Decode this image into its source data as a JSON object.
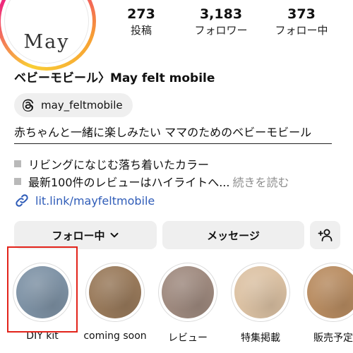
{
  "avatar": {
    "text": "May"
  },
  "stats": [
    {
      "value": "273",
      "label": "投稿"
    },
    {
      "value": "3,183",
      "label": "フォロワー"
    },
    {
      "value": "373",
      "label": "フォロー中"
    }
  ],
  "profile": {
    "name": "ベビーモビール〉May felt mobile",
    "threads_handle": "may_feltmobile"
  },
  "bio": {
    "line1": "赤ちゃんと一緒に楽しみたい ママのためのベビーモビール",
    "line2": "リビングになじむ落ち着いたカラー",
    "line3": "最新100件のレビューはハイライトへ...",
    "more": "続きを読む"
  },
  "link": {
    "text": "lit.link/mayfeltmobile"
  },
  "buttons": {
    "following": "フォロー中",
    "message": "メッセージ"
  },
  "highlights": [
    {
      "label": "DIY kit",
      "color": "#7f93a6"
    },
    {
      "label": "coming soon",
      "color": "#9a7b5c"
    },
    {
      "label": "レビュー",
      "color": "#a08b80"
    },
    {
      "label": "特集掲載",
      "color": "#dcc2a4"
    },
    {
      "label": "販売予定",
      "color": "#b98d62"
    }
  ],
  "colors": {
    "link": "#2f5cb8",
    "selection": "#e2231a",
    "button_bg": "#efefef"
  }
}
